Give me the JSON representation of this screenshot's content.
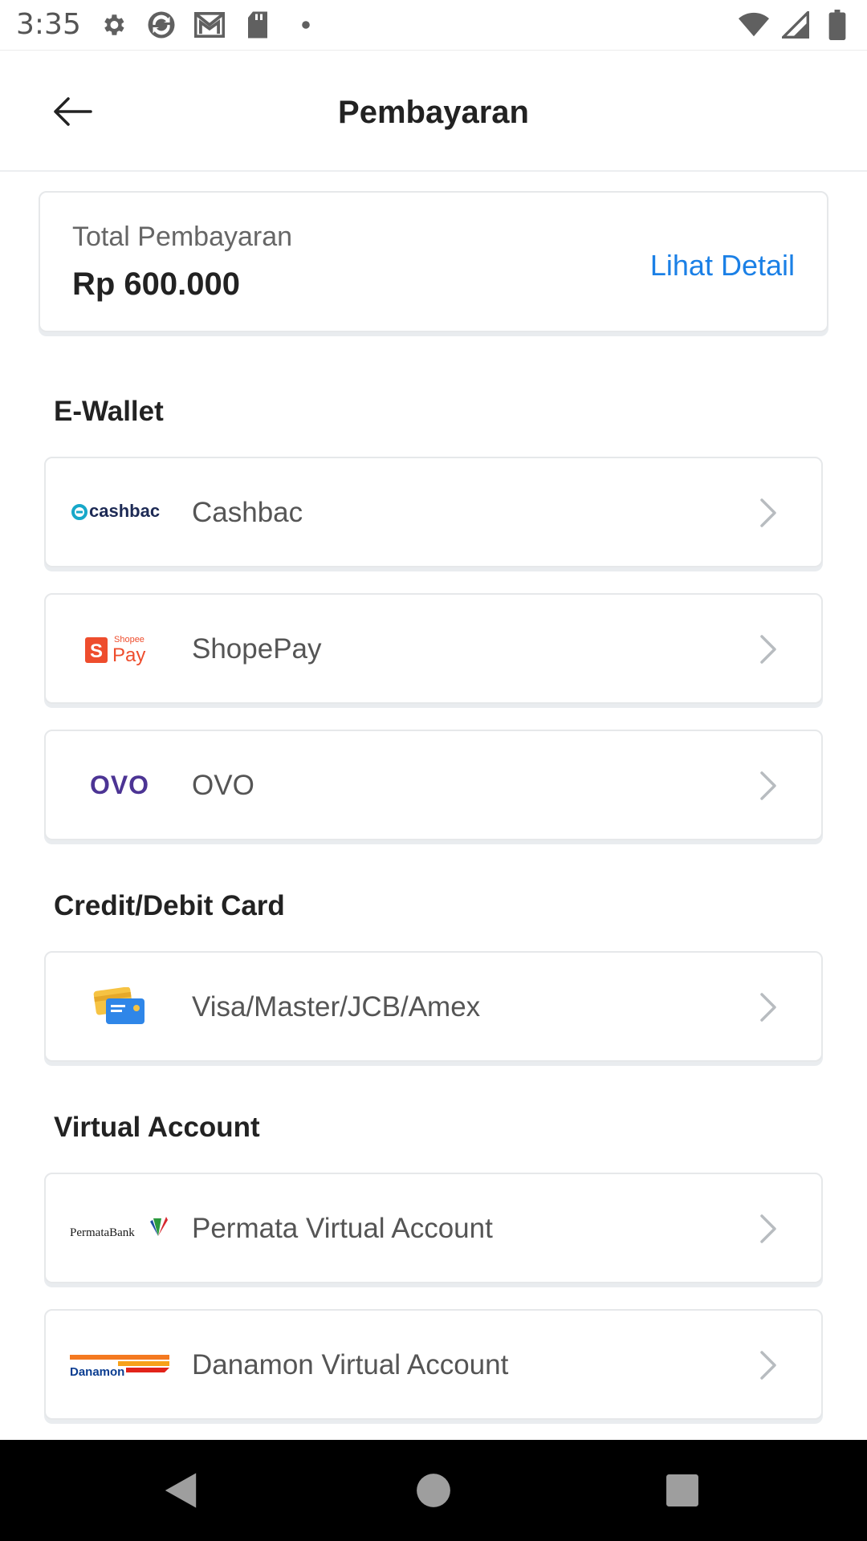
{
  "status_bar": {
    "time": "3:35",
    "icons": [
      "settings-icon",
      "sync-icon",
      "gmail-icon",
      "sd-card-icon",
      "dot-icon",
      "wifi-icon",
      "signal-icon",
      "battery-icon"
    ]
  },
  "header": {
    "title": "Pembayaran",
    "back_icon": "back-arrow-icon"
  },
  "total": {
    "label": "Total Pembayaran",
    "amount": "Rp 600.000",
    "detail_link": "Lihat Detail"
  },
  "sections": {
    "ewallet": {
      "title": "E-Wallet",
      "items": [
        {
          "label": "Cashbac",
          "logo": "cashbac"
        },
        {
          "label": "ShopePay",
          "logo": "shopeepay"
        },
        {
          "label": "OVO",
          "logo": "ovo"
        }
      ]
    },
    "card": {
      "title": "Credit/Debit Card",
      "items": [
        {
          "label": "Visa/Master/JCB/Amex",
          "logo": "credit-card-icon"
        }
      ]
    },
    "virtual_account": {
      "title": "Virtual Account",
      "items": [
        {
          "label": "Permata Virtual Account",
          "logo": "permatabank"
        },
        {
          "label": "Danamon Virtual Account",
          "logo": "danamon"
        }
      ]
    }
  },
  "logos": {
    "cashbac_text": "cashbac",
    "shopee_small": "Shopee",
    "shopee_pay": "Pay",
    "shopee_s": "S",
    "ovo_text": "OVO",
    "permata_text": "PermataBank",
    "danamon_text": "Danamon"
  },
  "colors": {
    "accent": "#1b80e6",
    "cashbac_teal": "#17a8c9",
    "shopee_orange": "#ee4d2d",
    "ovo_purple": "#4c3494",
    "danamon_orange": "#f47920",
    "danamon_text": "#0a3d91"
  },
  "nav": {
    "back": "nav-back-icon",
    "home": "nav-home-icon",
    "recents": "nav-recents-icon"
  }
}
